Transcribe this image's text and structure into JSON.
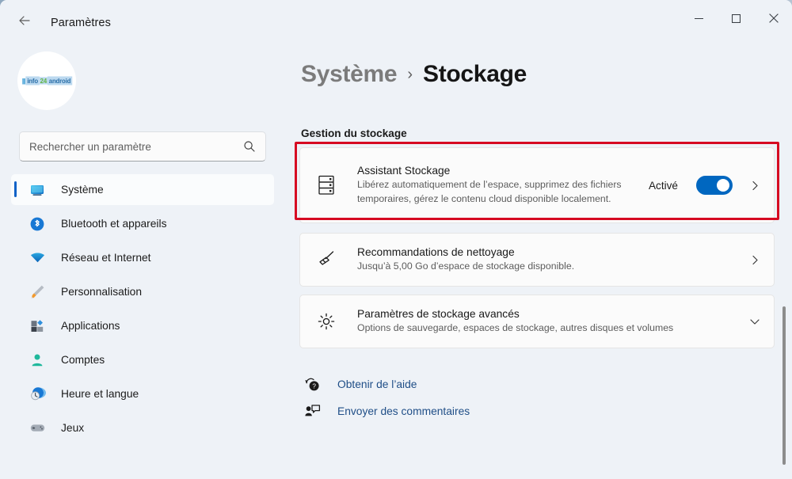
{
  "window": {
    "title": "Paramètres",
    "back_icon": "arrow-left-icon",
    "controls": {
      "minimize": "minimize-icon",
      "maximize": "maximize-icon",
      "close": "close-icon"
    }
  },
  "sidebar": {
    "avatar": {
      "name": "user-avatar",
      "logo_bars": "|||",
      "logo_info": "info",
      "logo_24": "24",
      "logo_android": "android"
    },
    "search": {
      "placeholder": "Rechercher un paramètre",
      "value": "",
      "icon": "search-icon"
    },
    "items": [
      {
        "label": "Système",
        "icon": "monitor-icon",
        "active": true
      },
      {
        "label": "Bluetooth et appareils",
        "icon": "bluetooth-icon",
        "active": false
      },
      {
        "label": "Réseau et Internet",
        "icon": "wifi-icon",
        "active": false
      },
      {
        "label": "Personnalisation",
        "icon": "paintbrush-icon",
        "active": false
      },
      {
        "label": "Applications",
        "icon": "apps-icon",
        "active": false
      },
      {
        "label": "Comptes",
        "icon": "person-icon",
        "active": false
      },
      {
        "label": "Heure et langue",
        "icon": "clock-globe-icon",
        "active": false
      },
      {
        "label": "Jeux",
        "icon": "gamepad-icon",
        "active": false
      }
    ]
  },
  "main": {
    "breadcrumb": {
      "parent": "Système",
      "separator": "›",
      "current": "Stockage"
    },
    "section_title": "Gestion du stockage",
    "cards": [
      {
        "title": "Assistant Stockage",
        "subtitle": "Libérez automatiquement de l’espace, supprimez des fichiers temporaires, gérez le contenu cloud disponible localement.",
        "icon": "drive-stack-icon",
        "toggle_label": "Activé",
        "toggle_on": true,
        "chevron": "chevron-right-icon",
        "highlighted": true
      },
      {
        "title": "Recommandations de nettoyage",
        "subtitle": "Jusqu’à 5,00 Go d’espace de stockage disponible.",
        "icon": "broom-icon",
        "chevron": "chevron-right-icon",
        "highlighted": false
      },
      {
        "title": "Paramètres de stockage avancés",
        "subtitle": "Options de sauvegarde, espaces de stockage, autres disques et volumes",
        "icon": "gear-icon",
        "chevron": "chevron-down-icon",
        "highlighted": false
      }
    ],
    "footer_links": [
      {
        "label": "Obtenir de l’aide",
        "icon": "help-question-icon"
      },
      {
        "label": "Envoyer des commentaires",
        "icon": "feedback-icon"
      }
    ]
  },
  "colors": {
    "accent": "#0067c0",
    "highlight": "#d60a22",
    "link": "#1f4e87",
    "window_bg": "#eef2f7",
    "card_bg": "#fbfbfb"
  }
}
